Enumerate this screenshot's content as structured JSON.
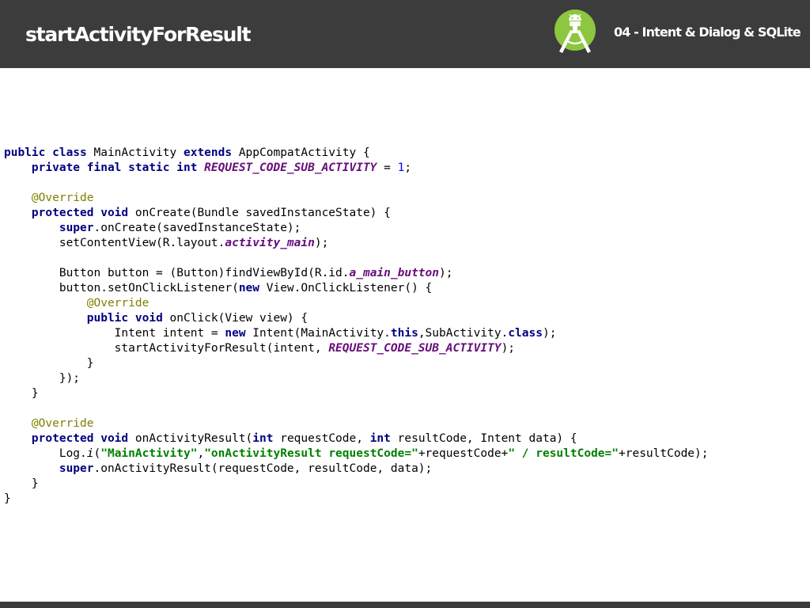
{
  "header": {
    "title": "startActivityForResult",
    "section": "04 - Intent & Dialog & SQLite",
    "logo_icon": "android-studio-icon"
  },
  "colors": {
    "header_bg": "#3c3c3c",
    "keyword": "#000080",
    "annotation": "#808000",
    "field": "#660e7a",
    "string": "#008000",
    "number": "#0000ff"
  },
  "code": {
    "language": "java",
    "lines": [
      [
        [
          "kw",
          "public class"
        ],
        [
          "pl",
          " MainActivity "
        ],
        [
          "kw",
          "extends"
        ],
        [
          "pl",
          " AppCompatActivity {"
        ]
      ],
      [
        [
          "pl",
          "    "
        ],
        [
          "kw",
          "private final static int"
        ],
        [
          "pl",
          " "
        ],
        [
          "fld",
          "REQUEST_CODE_SUB_ACTIVITY"
        ],
        [
          "pl",
          " = "
        ],
        [
          "num",
          "1"
        ],
        [
          "pl",
          ";"
        ]
      ],
      [],
      [
        [
          "pl",
          "    "
        ],
        [
          "ann",
          "@Override"
        ]
      ],
      [
        [
          "pl",
          "    "
        ],
        [
          "kw",
          "protected void"
        ],
        [
          "pl",
          " onCreate(Bundle savedInstanceState) {"
        ]
      ],
      [
        [
          "pl",
          "        "
        ],
        [
          "kw",
          "super"
        ],
        [
          "pl",
          ".onCreate(savedInstanceState);"
        ]
      ],
      [
        [
          "pl",
          "        setContentView(R.layout."
        ],
        [
          "fld",
          "activity_main"
        ],
        [
          "pl",
          ");"
        ]
      ],
      [],
      [
        [
          "pl",
          "        Button button = (Button)findViewById(R.id."
        ],
        [
          "fld",
          "a_main_button"
        ],
        [
          "pl",
          ");"
        ]
      ],
      [
        [
          "pl",
          "        button.setOnClickListener("
        ],
        [
          "kw",
          "new"
        ],
        [
          "pl",
          " View.OnClickListener() {"
        ]
      ],
      [
        [
          "pl",
          "            "
        ],
        [
          "ann",
          "@Override"
        ]
      ],
      [
        [
          "pl",
          "            "
        ],
        [
          "kw",
          "public void"
        ],
        [
          "pl",
          " onClick(View view) {"
        ]
      ],
      [
        [
          "pl",
          "                Intent intent = "
        ],
        [
          "kw",
          "new"
        ],
        [
          "pl",
          " Intent(MainActivity."
        ],
        [
          "kw",
          "this"
        ],
        [
          "pl",
          ",SubActivity."
        ],
        [
          "kw",
          "class"
        ],
        [
          "pl",
          ");"
        ]
      ],
      [
        [
          "pl",
          "                startActivityForResult(intent, "
        ],
        [
          "fld",
          "REQUEST_CODE_SUB_ACTIVITY"
        ],
        [
          "pl",
          ");"
        ]
      ],
      [
        [
          "pl",
          "            }"
        ]
      ],
      [
        [
          "pl",
          "        });"
        ]
      ],
      [
        [
          "pl",
          "    }"
        ]
      ],
      [],
      [
        [
          "pl",
          "    "
        ],
        [
          "ann",
          "@Override"
        ]
      ],
      [
        [
          "pl",
          "    "
        ],
        [
          "kw",
          "protected void"
        ],
        [
          "pl",
          " onActivityResult("
        ],
        [
          "kw",
          "int"
        ],
        [
          "pl",
          " requestCode, "
        ],
        [
          "kw",
          "int"
        ],
        [
          "pl",
          " resultCode, Intent data) {"
        ]
      ],
      [
        [
          "pl",
          "        Log."
        ],
        [
          "itl",
          "i"
        ],
        [
          "pl",
          "("
        ],
        [
          "str",
          "\"MainActivity\""
        ],
        [
          "pl",
          ","
        ],
        [
          "str",
          "\"onActivityResult requestCode=\""
        ],
        [
          "pl",
          "+requestCode+"
        ],
        [
          "str",
          "\" / resultCode=\""
        ],
        [
          "pl",
          "+resultCode);"
        ]
      ],
      [
        [
          "pl",
          "        "
        ],
        [
          "kw",
          "super"
        ],
        [
          "pl",
          ".onActivityResult(requestCode, resultCode, data);"
        ]
      ],
      [
        [
          "pl",
          "    }"
        ]
      ],
      [
        [
          "pl",
          "}"
        ]
      ]
    ]
  }
}
